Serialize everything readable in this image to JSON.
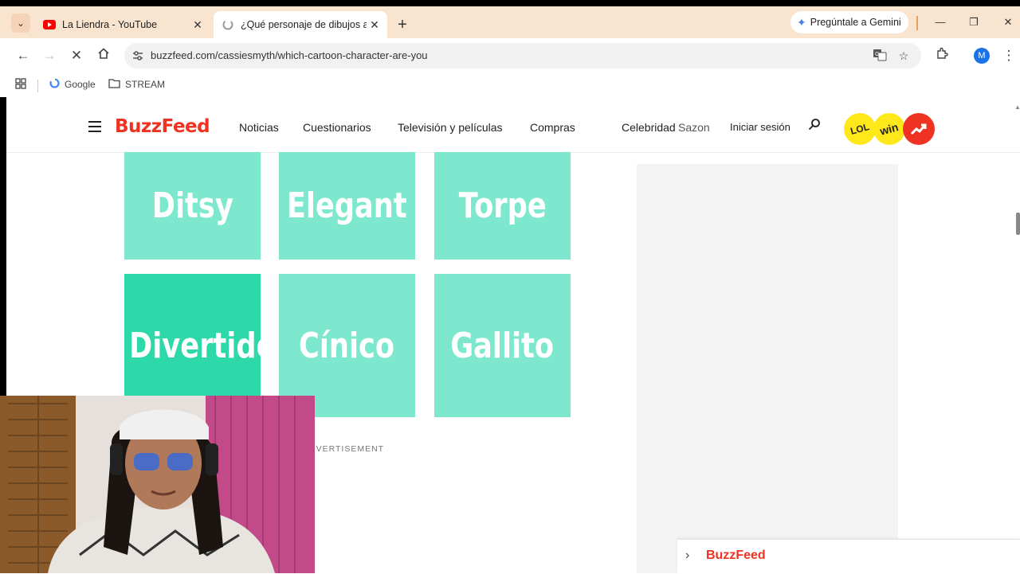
{
  "browser": {
    "tabs": [
      {
        "title": "La Liendra - YouTube",
        "icon": "youtube-icon"
      },
      {
        "title": "¿Qué personaje de dibujos animados eres?",
        "icon": "loading-icon"
      }
    ],
    "gemini_label": "Pregúntale a Gemini",
    "url": "buzzfeed.com/cassiesmyth/which-cartoon-character-are-you",
    "avatar_initial": "M",
    "bookmarks": [
      {
        "label": "Google",
        "icon": "google-icon"
      },
      {
        "label": "STREAM",
        "icon": "folder-icon"
      }
    ]
  },
  "site": {
    "logo": "BuzzFeed",
    "nav": [
      "Noticias",
      "Cuestionarios",
      "Televisión y películas",
      "Compras",
      "Celebridad",
      "Sazon"
    ],
    "signin": "Iniciar sesión",
    "badges": [
      "LOL",
      "win",
      "trending"
    ],
    "brand_color": "#ee3322"
  },
  "quiz": {
    "options": [
      "Ditsy",
      "Elegant",
      "Torpe",
      "Divertido",
      "Cínico",
      "Gallito"
    ],
    "selected_index": 3,
    "tile_color": "#7de8cd",
    "selected_color": "#2dd9a9"
  },
  "ad": {
    "label": "ADVERTISEMENT"
  },
  "bottom_bar": {
    "logo": "BuzzFeed"
  }
}
